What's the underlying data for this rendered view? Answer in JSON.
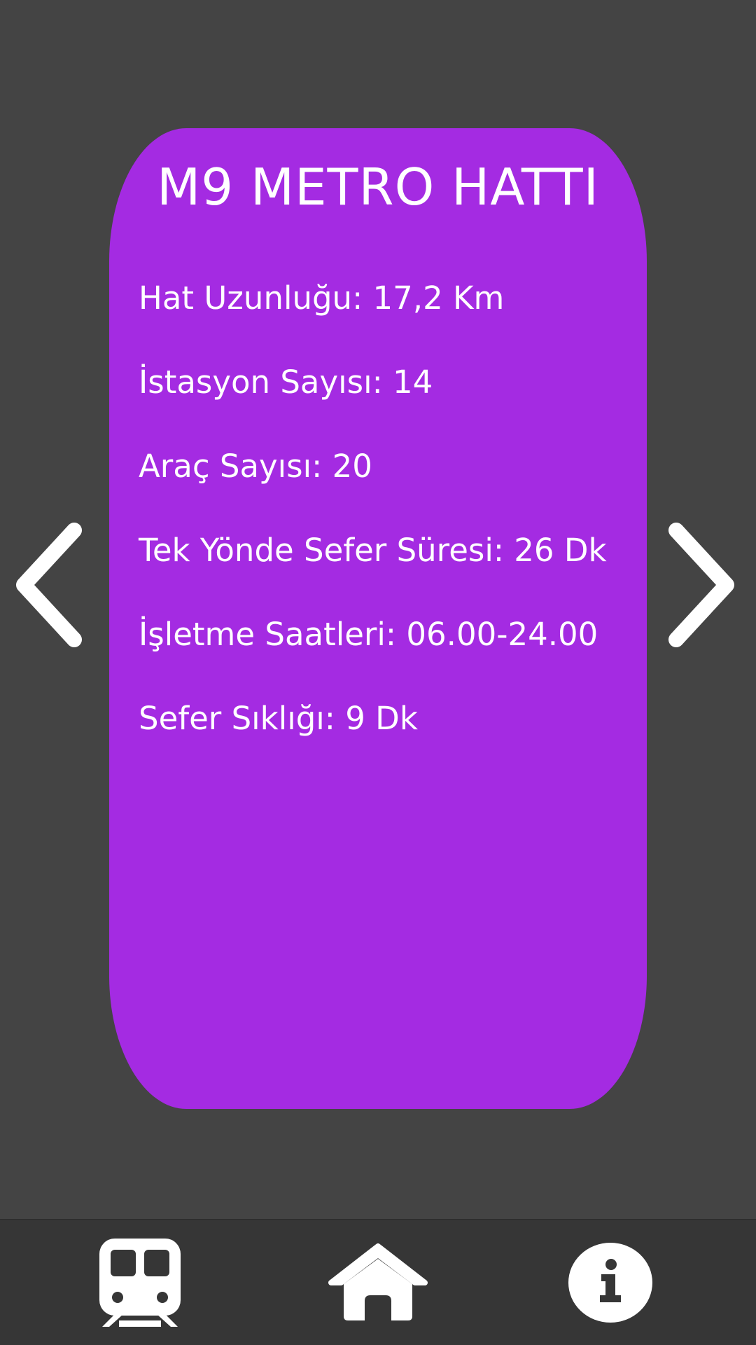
{
  "card": {
    "title": "M9 METRO HATTI",
    "color": "#a42be2",
    "rows": [
      "Hat Uzunluğu: 17,2 Km",
      "İstasyon Sayısı: 14",
      "Araç Sayısı: 20",
      "Tek Yönde Sefer Süresi: 26 Dk",
      "İşletme Saatleri: 06.00-24.00",
      "Sefer Sıklığı: 9 Dk"
    ]
  },
  "navigation": {
    "prev_icon": "chevron-left-icon",
    "next_icon": "chevron-right-icon"
  },
  "bottom_nav": {
    "items": [
      {
        "icon": "train-icon"
      },
      {
        "icon": "home-icon"
      },
      {
        "icon": "info-icon"
      }
    ]
  },
  "colors": {
    "background": "#444444",
    "bottom_bar": "#363636",
    "text": "#ffffff"
  }
}
